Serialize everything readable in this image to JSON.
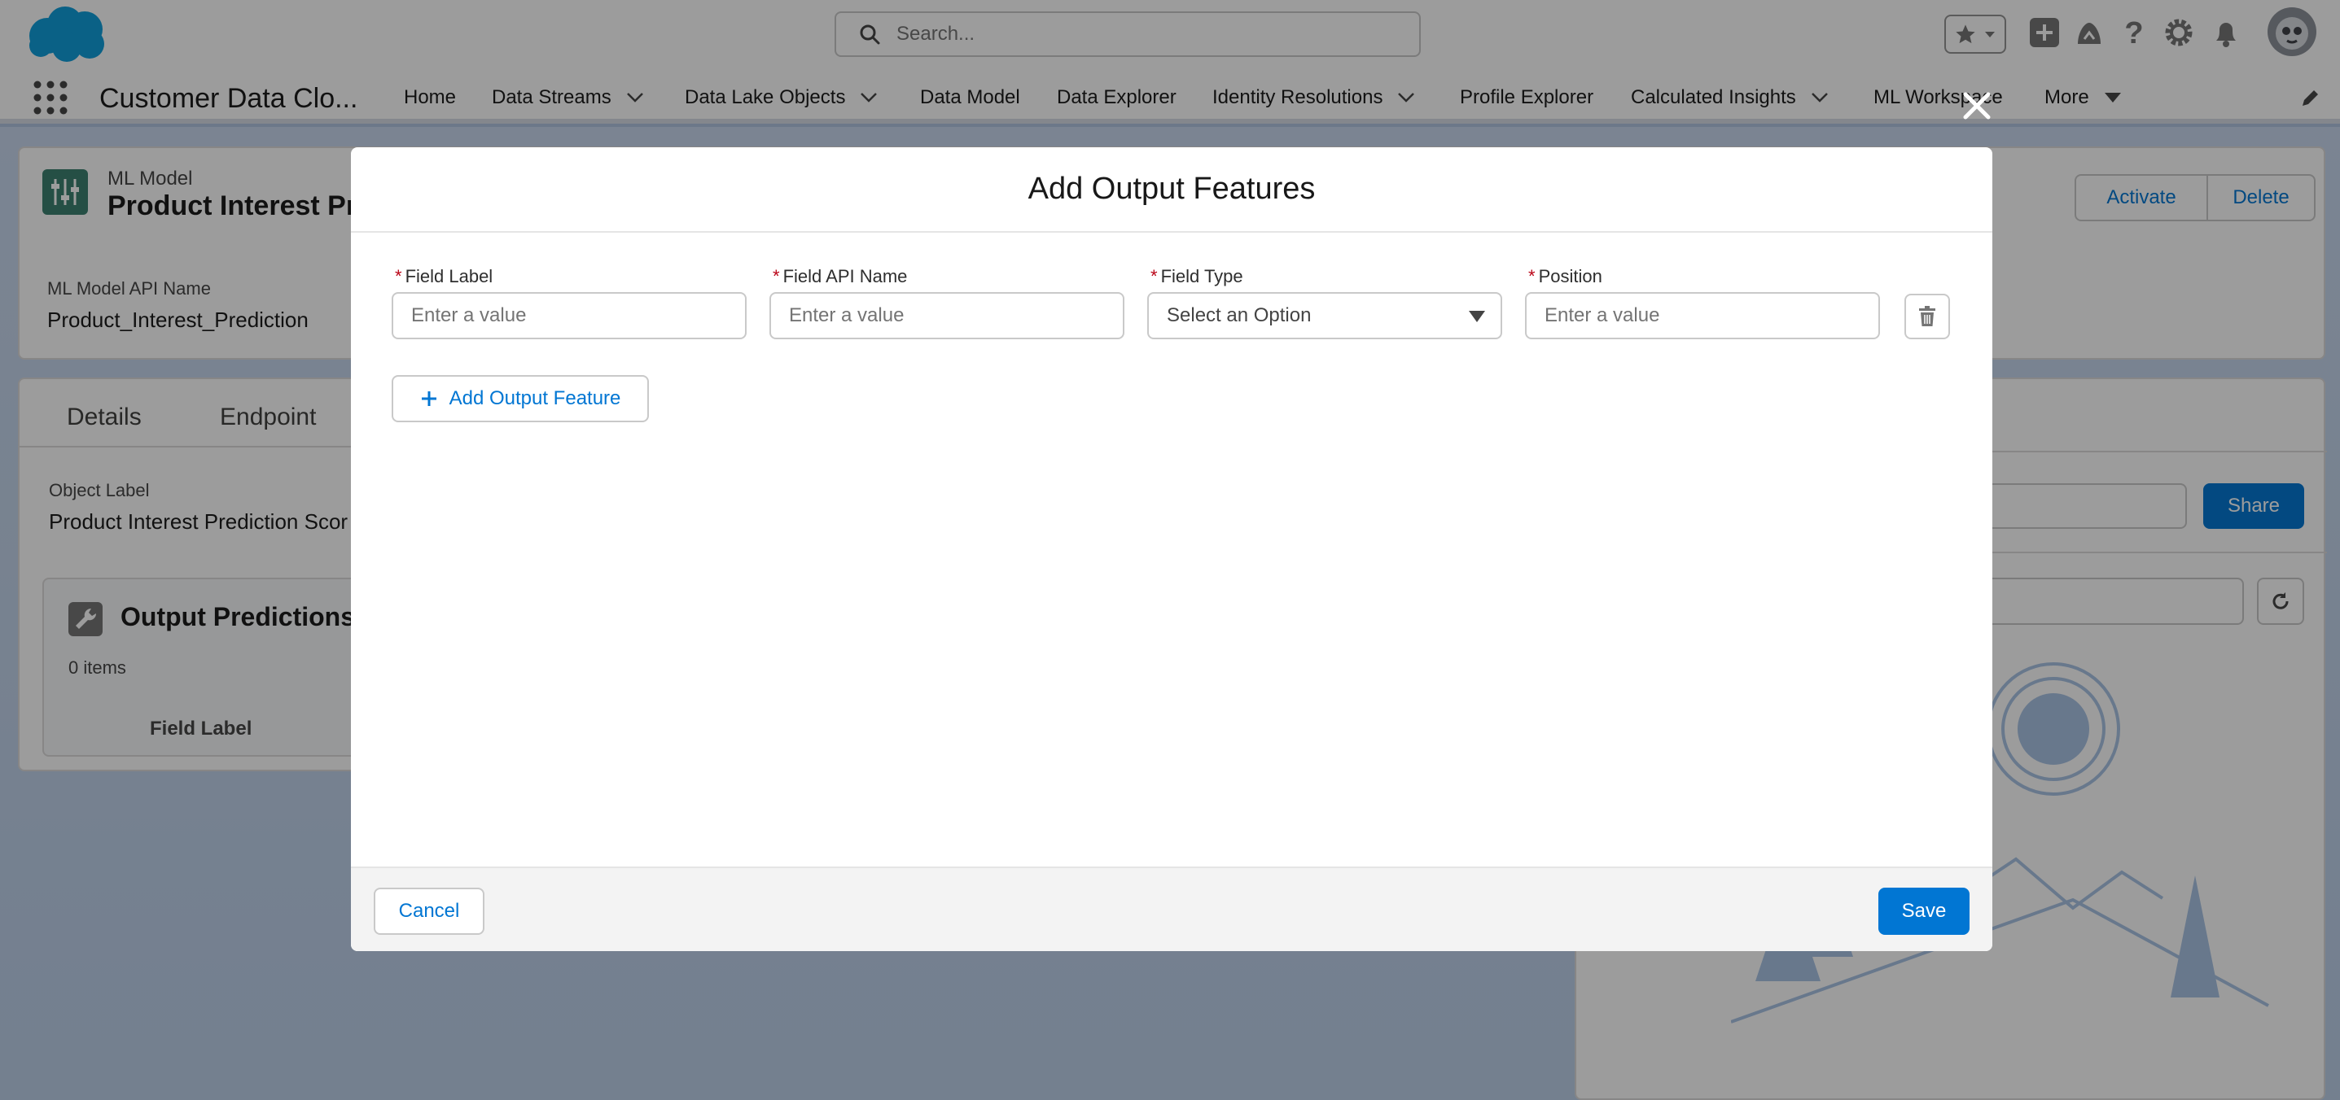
{
  "global_header": {
    "search_placeholder": "Search..."
  },
  "nav": {
    "app_name": "Customer Data Clo...",
    "items": [
      {
        "label": "Home"
      },
      {
        "label": "Data Streams"
      },
      {
        "label": "Data Lake Objects"
      },
      {
        "label": "Data Model"
      },
      {
        "label": "Data Explorer"
      },
      {
        "label": "Identity Resolutions"
      },
      {
        "label": "Profile Explorer"
      },
      {
        "label": "Calculated Insights"
      },
      {
        "label": "ML Workspace"
      },
      {
        "label": "More"
      }
    ]
  },
  "record": {
    "object_type": "ML Model",
    "title": "Product Interest Pre",
    "api_name_label": "ML Model API Name",
    "api_name_value": "Product_Interest_Prediction",
    "actions": {
      "activate": "Activate",
      "delete": "Delete"
    },
    "tabs": [
      {
        "label": "Details"
      },
      {
        "label": "Endpoint"
      }
    ],
    "object_label_label": "Object Label",
    "object_label_value": "Product Interest Prediction Scor",
    "related_title": "Output Predictions",
    "items_count": "0 items",
    "column_field_label": "Field Label",
    "share_label": "Share",
    "search_placeholder": "...l..."
  },
  "modal": {
    "title": "Add Output Features",
    "fields": [
      {
        "label": "Field Label",
        "placeholder": "Enter a value"
      },
      {
        "label": "Field API Name",
        "placeholder": "Enter a value"
      },
      {
        "label": "Field Type",
        "placeholder": "Select an Option"
      },
      {
        "label": "Position",
        "placeholder": "Enter a value"
      }
    ],
    "required_marker": "*",
    "add_feature_label": "Add Output Feature",
    "cancel_label": "Cancel",
    "save_label": "Save"
  },
  "colors": {
    "brand": "#0176d3",
    "required": "#ba0517",
    "overlay": "rgba(8,7,7,0.40)"
  }
}
